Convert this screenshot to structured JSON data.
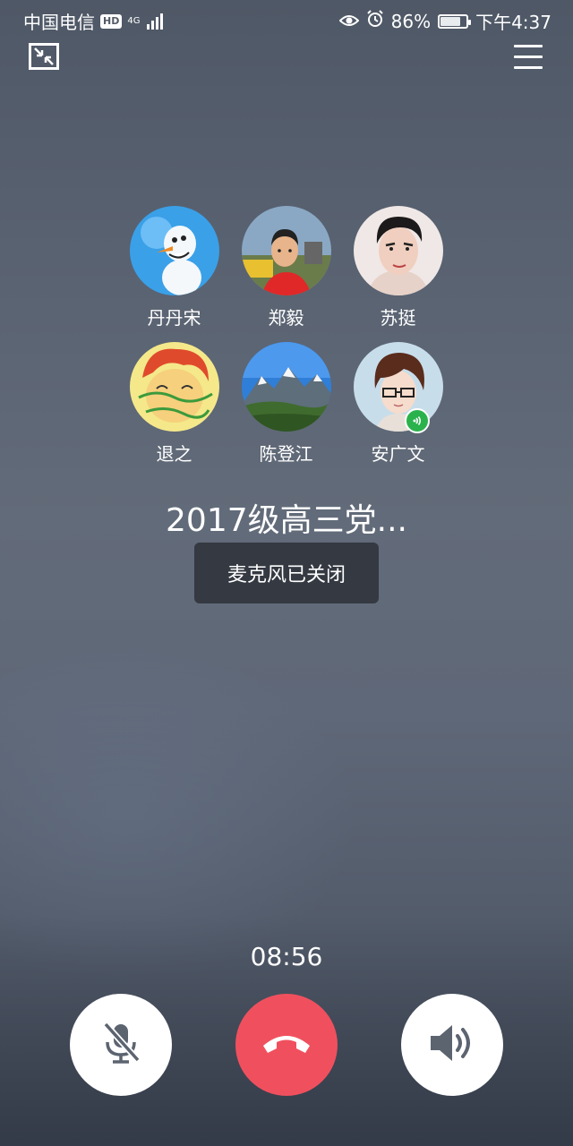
{
  "status_bar": {
    "carrier": "中国电信",
    "hd": "HD",
    "network": "4G",
    "battery": "86%",
    "battery_level": 0.86,
    "time": "下午4:37",
    "icons": [
      "eye-comfort-icon",
      "alarm-icon",
      "battery-icon"
    ]
  },
  "top_bar": {
    "left_icon": "minimize-icon",
    "right_icon": "menu-icon"
  },
  "participants": [
    {
      "name": "丹丹宋",
      "avatar": "snowman-avatar",
      "speaking": false
    },
    {
      "name": "郑毅",
      "avatar": "boy-avatar",
      "speaking": false
    },
    {
      "name": "苏挺",
      "avatar": "man-avatar",
      "speaking": false
    },
    {
      "name": "退之",
      "avatar": "cartoon-avatar",
      "speaking": false
    },
    {
      "name": "陈登江",
      "avatar": "mountain-avatar",
      "speaking": false
    },
    {
      "name": "安广文",
      "avatar": "anime-boy-avatar",
      "speaking": true
    }
  ],
  "group_name": "2017级高三党...",
  "toast": "麦克风已关闭",
  "call_duration": "08:56",
  "controls": {
    "mute": {
      "icon": "mic-off-icon",
      "active": true
    },
    "hangup": {
      "icon": "hang-up-icon",
      "color": "#f0505e"
    },
    "speaker": {
      "icon": "speaker-icon"
    }
  }
}
